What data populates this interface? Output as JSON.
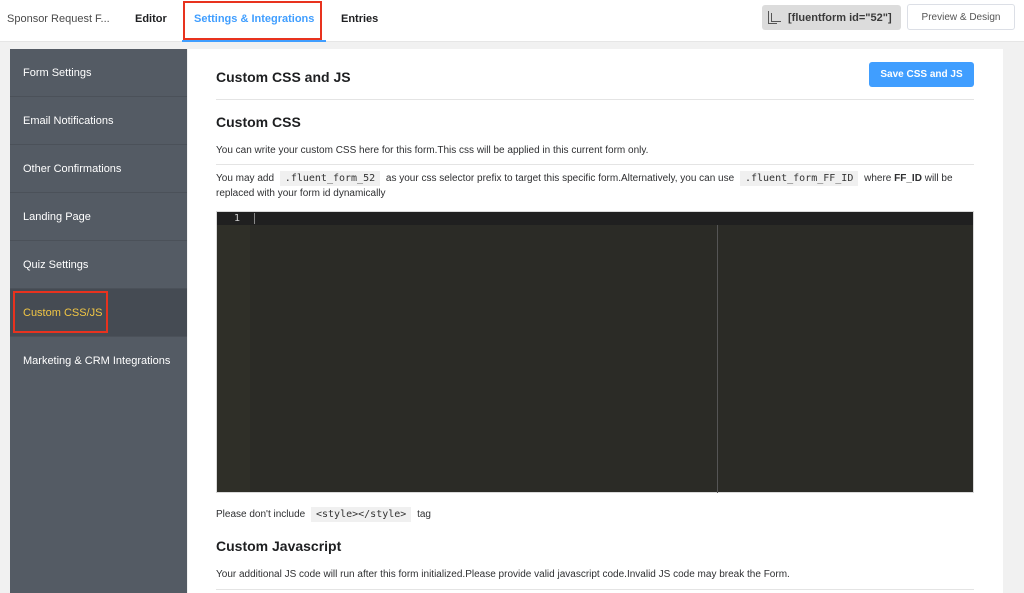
{
  "topbar": {
    "form_title": "Sponsor Request F...",
    "tabs": [
      {
        "label": "Editor",
        "active": false
      },
      {
        "label": "Settings & Integrations",
        "active": true
      },
      {
        "label": "Entries",
        "active": false
      }
    ],
    "shortcode": "[fluentform id=\"52\"]",
    "shortcode_icon": "copy-icon",
    "preview_button": "Preview & Design"
  },
  "sidebar": {
    "items": [
      {
        "label": "Form Settings",
        "active": false
      },
      {
        "label": "Email Notifications",
        "active": false
      },
      {
        "label": "Other Confirmations",
        "active": false
      },
      {
        "label": "Landing Page",
        "active": false
      },
      {
        "label": "Quiz Settings",
        "active": false
      },
      {
        "label": "Custom CSS/JS",
        "active": true
      },
      {
        "label": "Marketing & CRM Integrations",
        "active": false
      }
    ]
  },
  "main": {
    "title": "Custom CSS and JS",
    "save_button": "Save CSS and JS",
    "css_section": {
      "heading": "Custom CSS",
      "description": "You can write your custom CSS here for this form.This css will be applied in this current form only.",
      "hint_part1": "You may add",
      "hint_code1": ".fluent_form_52",
      "hint_part2": "as your css selector prefix to target this specific form.Alternatively, you can use",
      "hint_code2": ".fluent_form_FF_ID",
      "hint_part3": "where",
      "hint_bold": "FF_ID",
      "hint_part4": "will be replaced with your form id dynamically",
      "editor": {
        "line_numbers": [
          "1"
        ],
        "content": ""
      },
      "note_part1": "Please don't include",
      "note_code": "<style></style>",
      "note_part2": "tag"
    },
    "js_section": {
      "heading": "Custom Javascript",
      "description": "Your additional JS code will run after this form initialized.Please provide valid javascript code.Invalid JS code may break the Form."
    }
  },
  "colors": {
    "accent": "#409eff",
    "sidebar_bg": "#545b64",
    "sidebar_active_text": "#f1c644",
    "highlight_box": "#e8321e",
    "editor_bg": "#2b2b26"
  }
}
